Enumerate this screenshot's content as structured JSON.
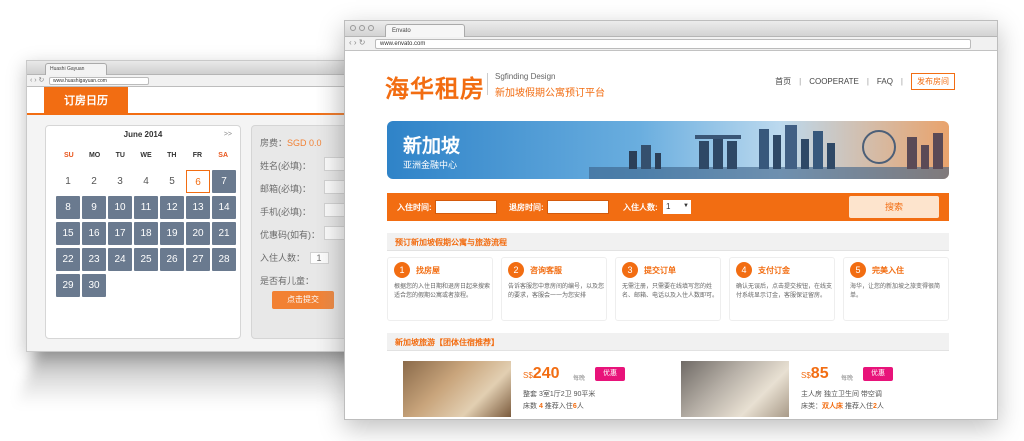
{
  "back_window": {
    "tab_title": "Huashi Gayuan",
    "url": "www.huashigayuan.com",
    "nav_tab": "订房日历",
    "calendar": {
      "month": "June 2014",
      "next": ">>",
      "weekdays": [
        "SU",
        "MO",
        "TU",
        "WE",
        "TH",
        "FR",
        "SA"
      ],
      "rows": [
        [
          "1",
          "2",
          "3",
          "4",
          "5",
          "6",
          "7"
        ],
        [
          "8",
          "9",
          "10",
          "11",
          "12",
          "13",
          "14"
        ],
        [
          "15",
          "16",
          "17",
          "18",
          "19",
          "20",
          "21"
        ],
        [
          "22",
          "23",
          "24",
          "25",
          "26",
          "27",
          "28"
        ],
        [
          "29",
          "30",
          "",
          "",
          "",
          "",
          ""
        ]
      ]
    },
    "form": {
      "price_label": "房费：",
      "price_value": "SGD 0.0",
      "name_label": "姓名(必填)：",
      "email_label": "邮箱(必填)：",
      "phone_label": "手机(必填)：",
      "promo_label": "优惠码(如有)：",
      "guests_label": "入住人数：",
      "guests_value": "1",
      "children_label": "是否有儿童：",
      "submit": "点击提交"
    }
  },
  "front_window": {
    "tab_title": "Envato",
    "url": "www.envato.com",
    "logo": "海华租房",
    "tagline_en": "Sgfinding Design",
    "tagline_cn": "新加坡假期公寓预订平台",
    "nav": [
      "首页",
      "COOPERATE",
      "FAQ",
      "发布房间"
    ],
    "banner": {
      "title": "新加坡",
      "subtitle": "亚洲金融中心"
    },
    "search": {
      "checkin_label": "入住时间:",
      "checkout_label": "退房时间:",
      "guests_label": "入住人数:",
      "guests_value": "1",
      "button": "搜索"
    },
    "process_title": "预订新加坡假期公寓与旅游流程",
    "steps": [
      {
        "num": "1",
        "title": "找房屋",
        "desc": "根据您的入住日期和退房日起来搜索适合您的假期公寓或者旅程。"
      },
      {
        "num": "2",
        "title": "咨询客服",
        "desc": "告诉客服您中意房间的编号，以及您的要求，客服会一一为您安排"
      },
      {
        "num": "3",
        "title": "提交订单",
        "desc": "无需注册，只需要在线填写您的姓名、邮箱、电话以及入住人数即可。"
      },
      {
        "num": "4",
        "title": "支付订金",
        "desc": "确认无误后，点击提交按钮，在线支付系统显示订金，客服保证留房。"
      },
      {
        "num": "5",
        "title": "完美入住",
        "desc": "海华，让您的新加坡之旅变得很简单。"
      }
    ],
    "tour_title": "新加坡旅游【团体住宿推荐】",
    "listings": [
      {
        "currency": "S$",
        "price": "240",
        "per": "每晚",
        "badge": "优惠",
        "line1": "整套  3室1厅2卫  90平米",
        "line2a": "床数 ",
        "beds": "4",
        "line2b": "  推荐入住",
        "guests": "6",
        "line2c": "人"
      },
      {
        "currency": "S$",
        "price": "85",
        "per": "每晚",
        "badge": "优惠",
        "line1": "主人房  独立卫生间  带空调",
        "line2a": "床类：",
        "beds": "双人床",
        "line2b": "  推荐入住",
        "guests": "2",
        "line2c": "人"
      }
    ]
  }
}
